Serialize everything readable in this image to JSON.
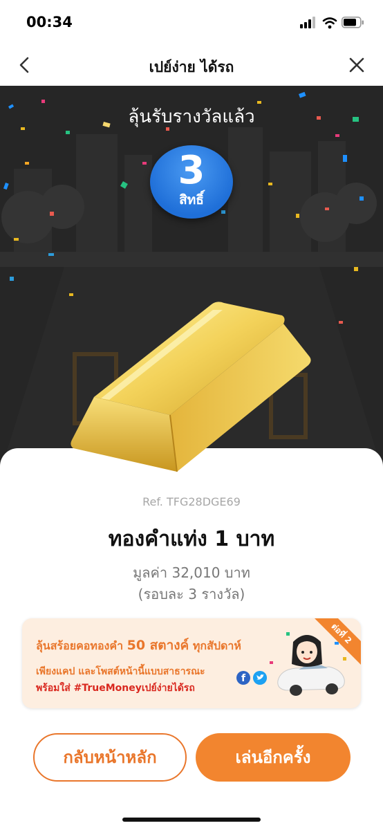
{
  "status_bar": {
    "time": "00:34"
  },
  "nav": {
    "title": "เปย์ง่าย ได้รถ"
  },
  "hero": {
    "heading": "ลุ้นรับรางวัลแล้ว",
    "rights_count": "3",
    "rights_unit": "สิทธิ์"
  },
  "prize": {
    "ref": "Ref. TFG28DGE69",
    "name": "ทองคำแท่ง 1 บาท",
    "value": "มูลค่า 32,010 บาท",
    "round": "(รอบละ 3 รางวัล)"
  },
  "promo": {
    "line1_prefix": "ลุ้นสร้อยคอทองคำ ",
    "line1_highlight": "50 สตางค์",
    "line1_suffix": " ทุกสัปดาห์",
    "line2": "เพียงแคป และโพสต์หน้านี้แบบสาธารณะ",
    "line3": "พร้อมใส่ #TrueMoneyเปย์ง่ายได้รถ",
    "corner": "ต่อที่ 2",
    "facebook_glyph": "f"
  },
  "buttons": {
    "home": "กลับหน้าหลัก",
    "play_again": "เล่นอีกครั้ง"
  },
  "colors": {
    "accent": "#f2852f",
    "badge": "#1f6fd8",
    "hero_bg": "#262626"
  }
}
